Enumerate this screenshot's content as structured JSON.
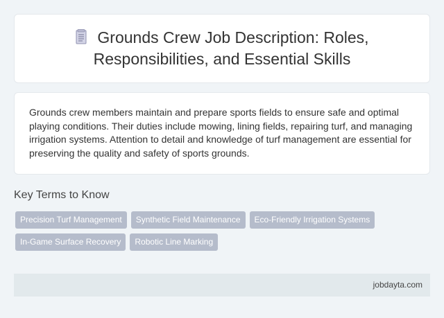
{
  "header": {
    "icon": "document-icon",
    "title": "Grounds Crew Job Description: Roles, Responsibilities, and Essential Skills"
  },
  "summary": {
    "text": "Grounds crew members maintain and prepare sports fields to ensure safe and optimal playing conditions. Their duties include mowing, lining fields, repairing turf, and managing irrigation systems. Attention to detail and knowledge of turf management are essential for preserving the quality and safety of sports grounds."
  },
  "key_terms": {
    "heading": "Key Terms to Know",
    "tags": [
      "Precision Turf Management",
      "Synthetic Field Maintenance",
      "Eco-Friendly Irrigation Systems",
      "In-Game Surface Recovery",
      "Robotic Line Marking"
    ]
  },
  "footer": {
    "source": "jobdayta.com"
  },
  "colors": {
    "background": "#f0f4f7",
    "card": "#ffffff",
    "tag": "#b5bccb",
    "footer": "#e2e9ec"
  }
}
